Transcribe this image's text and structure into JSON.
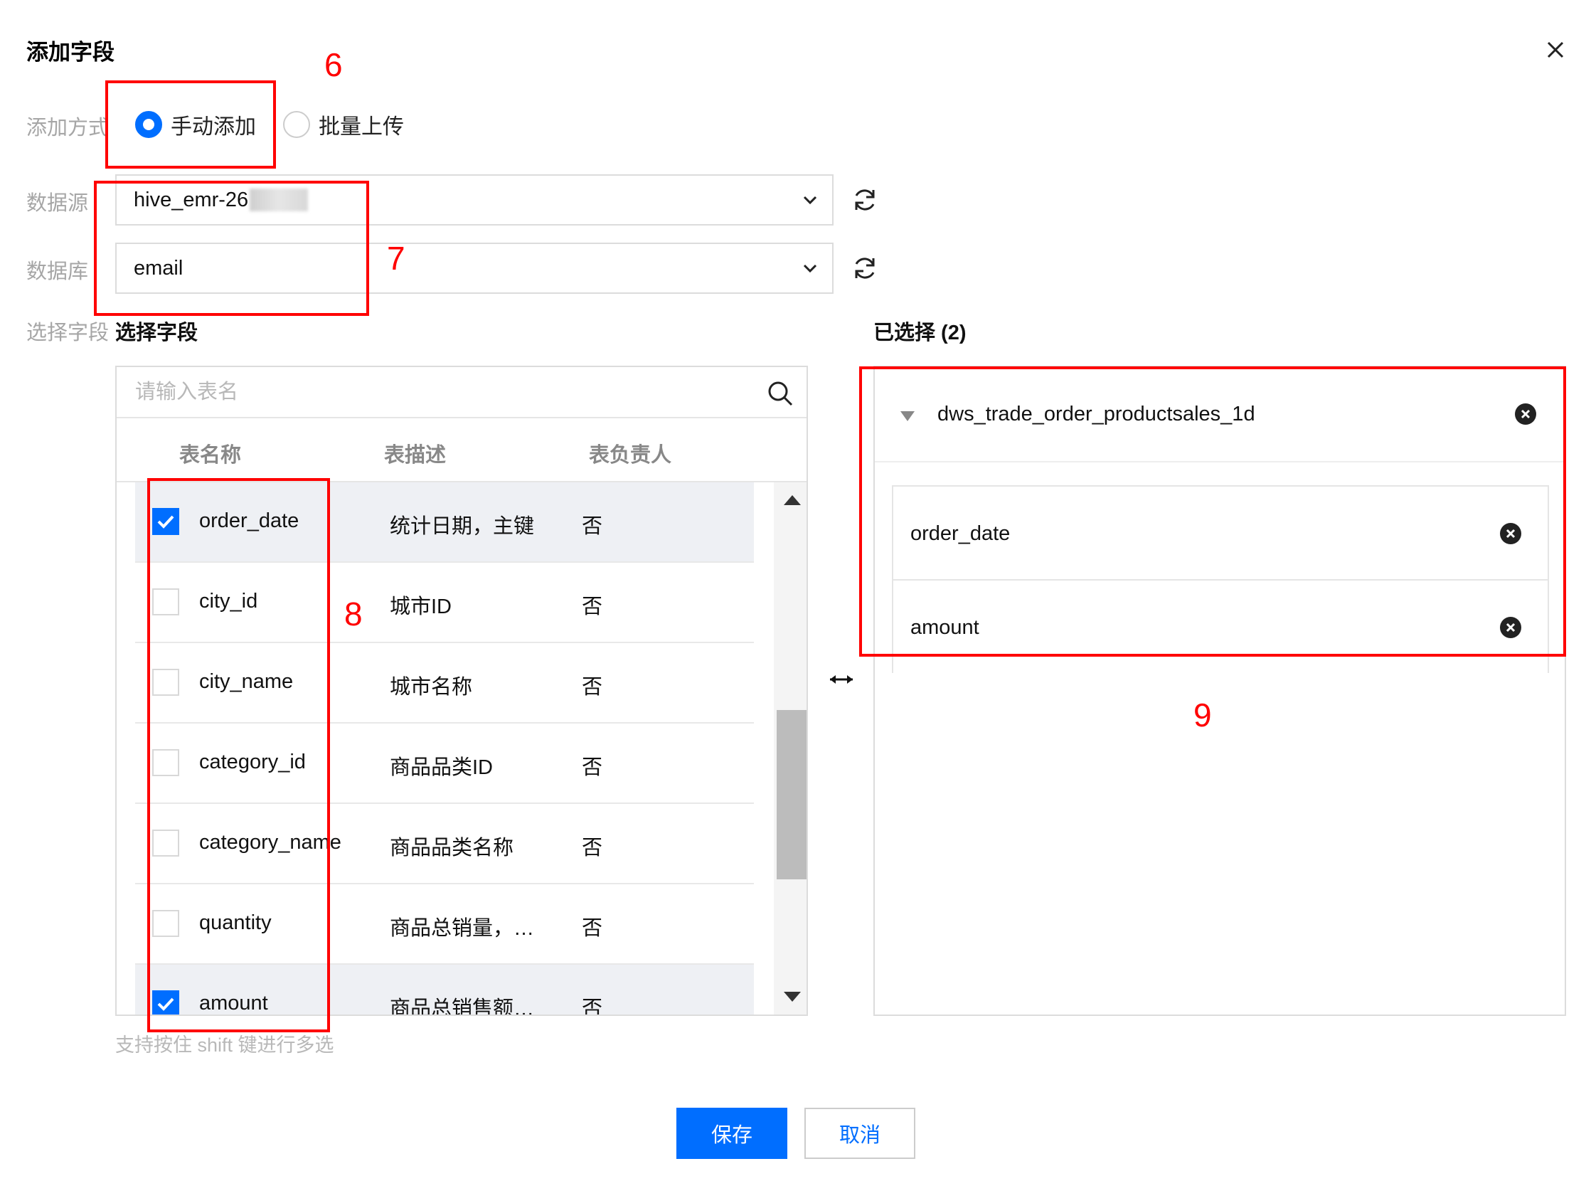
{
  "dialog": {
    "title": "添加字段"
  },
  "form": {
    "add_method_label": "添加方式",
    "add_method_options": [
      {
        "label": "手动添加",
        "checked": true
      },
      {
        "label": "批量上传",
        "checked": false
      }
    ],
    "datasource_label": "数据源",
    "datasource_value": "hive_emr-26",
    "database_label": "数据库",
    "database_value": "email",
    "select_field_label": "选择字段"
  },
  "left_panel": {
    "title": "选择字段",
    "search_placeholder": "请输入表名",
    "columns": [
      "表名称",
      "表描述",
      "表负责人"
    ],
    "rows": [
      {
        "name": "order_date",
        "desc": "统计日期，主键",
        "owner": "否",
        "checked": true
      },
      {
        "name": "city_id",
        "desc": "城市ID",
        "owner": "否",
        "checked": false
      },
      {
        "name": "city_name",
        "desc": "城市名称",
        "owner": "否",
        "checked": false
      },
      {
        "name": "category_id",
        "desc": "商品品类ID",
        "owner": "否",
        "checked": false
      },
      {
        "name": "category_name",
        "desc": "商品品类名称",
        "owner": "否",
        "checked": false
      },
      {
        "name": "quantity",
        "desc": "商品总销量，…",
        "owner": "否",
        "checked": false
      },
      {
        "name": "amount",
        "desc": "商品总销售额…",
        "owner": "否",
        "checked": true
      }
    ],
    "hint": "支持按住 shift 键进行多选"
  },
  "right_panel": {
    "title": "已选择 (2)",
    "group": "dws_trade_order_productsales_1d",
    "items": [
      "order_date",
      "amount"
    ]
  },
  "buttons": {
    "save": "保存",
    "cancel": "取消"
  },
  "annotations": [
    "6",
    "7",
    "8",
    "9"
  ],
  "colors": {
    "primary": "#006eff",
    "annotation": "#ff0000"
  }
}
